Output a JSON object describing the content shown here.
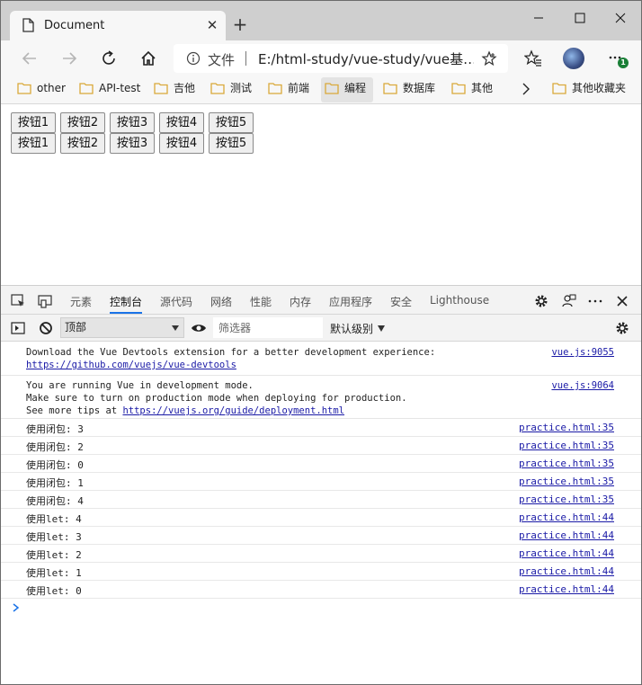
{
  "browser": {
    "tab_title": "Document",
    "omnibox": {
      "scheme_label": "文件",
      "url": "E:/html-study/vue-study/vue基…"
    },
    "badge": "1"
  },
  "bookmarks": [
    {
      "label": "other"
    },
    {
      "label": "API-test"
    },
    {
      "label": "吉他"
    },
    {
      "label": "测试"
    },
    {
      "label": "前端"
    },
    {
      "label": "编程"
    },
    {
      "label": "数据库"
    },
    {
      "label": "其他"
    },
    {
      "label": "其他收藏夹"
    }
  ],
  "page": {
    "row1": [
      "按钮1",
      "按钮2",
      "按钮3",
      "按钮4",
      "按钮5"
    ],
    "row2": [
      "按钮1",
      "按钮2",
      "按钮3",
      "按钮4",
      "按钮5"
    ]
  },
  "devtools": {
    "tabs": [
      "元素",
      "控制台",
      "源代码",
      "网络",
      "性能",
      "内存",
      "应用程序",
      "安全",
      "Lighthouse"
    ],
    "active_tab": "控制台",
    "context": "顶部",
    "filter_placeholder": "筛选器",
    "levels": "默认级别",
    "messages": [
      {
        "line1": "Download the Vue Devtools extension for a better development experience:",
        "link": "https://github.com/vuejs/vue-devtools",
        "source": "vue.js:9055"
      },
      {
        "line1": "You are running Vue in development mode.",
        "line2": "Make sure to turn on production mode when deploying for production.",
        "line3_prefix": "See more tips at ",
        "link": "https://vuejs.org/guide/deployment.html",
        "source": "vue.js:9064"
      }
    ],
    "logs": [
      {
        "text": "使用闭包: 3",
        "source": "practice.html:35"
      },
      {
        "text": "使用闭包: 2",
        "source": "practice.html:35"
      },
      {
        "text": "使用闭包: 0",
        "source": "practice.html:35"
      },
      {
        "text": "使用闭包: 1",
        "source": "practice.html:35"
      },
      {
        "text": "使用闭包: 4",
        "source": "practice.html:35"
      },
      {
        "text": "使用let: 4",
        "source": "practice.html:44"
      },
      {
        "text": "使用let: 3",
        "source": "practice.html:44"
      },
      {
        "text": "使用let: 2",
        "source": "practice.html:44"
      },
      {
        "text": "使用let: 1",
        "source": "practice.html:44"
      },
      {
        "text": "使用let: 0",
        "source": "practice.html:44"
      }
    ]
  },
  "colors": {
    "accent": "#1a73e8",
    "link": "#1a1aa6",
    "folder": "#e8b84a"
  }
}
